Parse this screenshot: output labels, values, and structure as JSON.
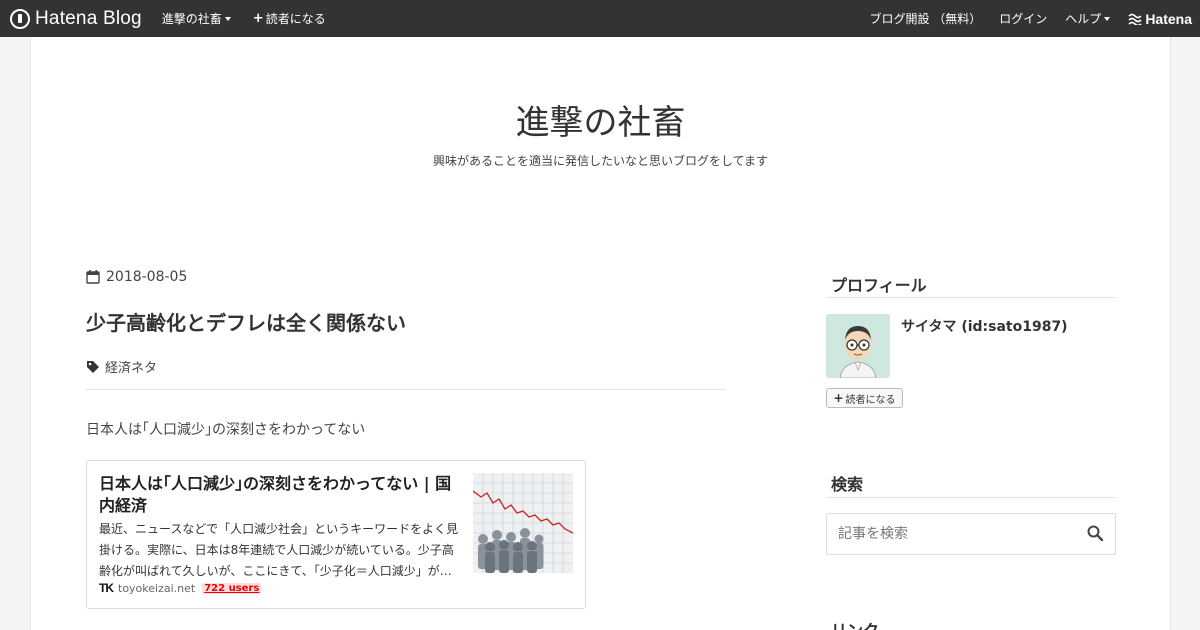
{
  "topbar": {
    "logo_text": "Hatena Blog",
    "blog_menu_label": "進撃の社畜",
    "follow_label": "読者になる",
    "open_blog_label": "ブログ開設 （無料）",
    "login_label": "ログイン",
    "help_label": "ヘルプ",
    "hatena_label": "Hatena"
  },
  "blog": {
    "title": "進撃の社畜",
    "description": "興味があることを適当に発信したいなと思いブログをしてます"
  },
  "entry": {
    "date": "2018-08-05",
    "title": "少子高齢化とデフレは全く関係ない",
    "category": "経済ネタ",
    "intro": "日本人は｢人口減少｣の深刻さをわかってない",
    "embed": {
      "title": "日本人は｢人口減少｣の深刻さをわかってない | 国内経済",
      "description": "最近、ニュースなどで「人口減少社会」というキーワードをよく見掛ける。実際に、日本は8年連続で人口減少が続いている。少子高齢化が叫ばれて久しいが、ここにきて、「少子化＝人口減少」が…",
      "logo_text": "TK",
      "domain": "toyokeizai.net",
      "users": "722 users"
    }
  },
  "sidebar": {
    "profile_heading": "プロフィール",
    "profile_name": "サイタマ (id:sato1987)",
    "follow_button": "読者になる",
    "search_heading": "検索",
    "search_placeholder": "記事を検索",
    "links_heading": "リンク"
  },
  "colors": {
    "topbar_bg": "#333333",
    "users_red": "#ee0000"
  }
}
